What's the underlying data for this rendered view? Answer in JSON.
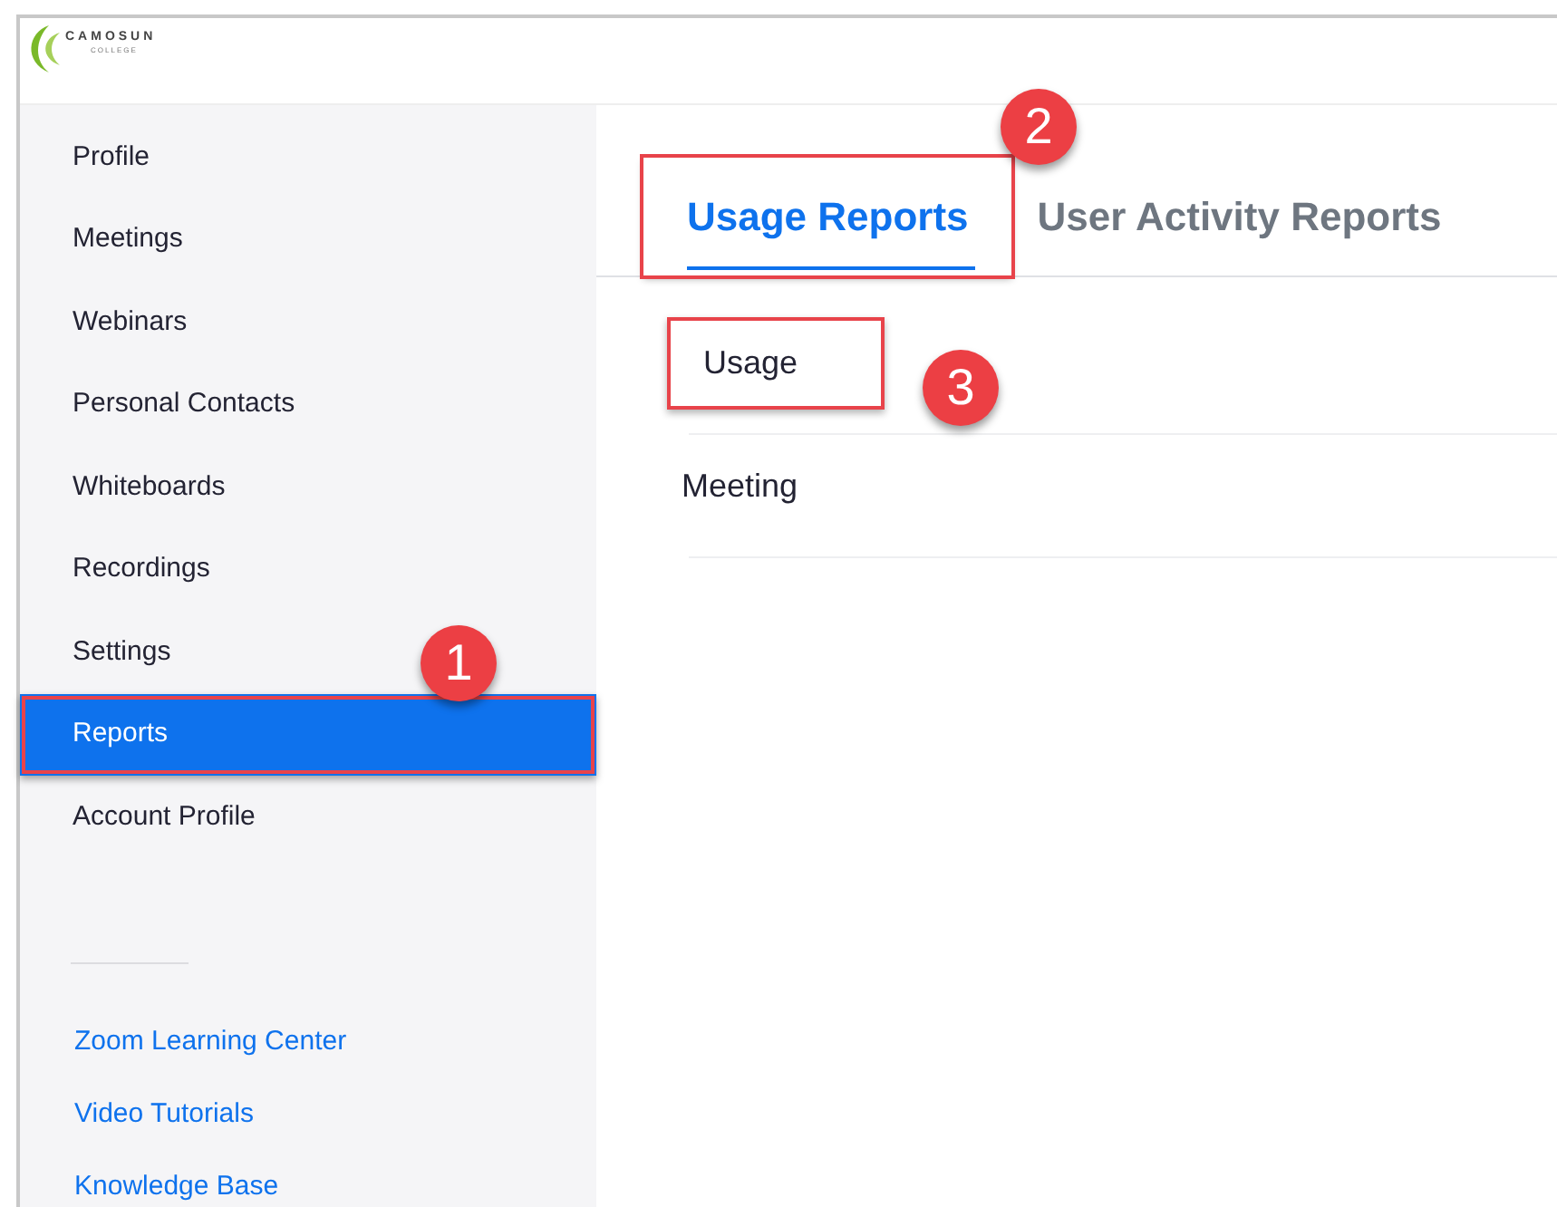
{
  "logo": {
    "name": "CAMOSUN",
    "subtitle": "COLLEGE"
  },
  "sidebar": {
    "items": [
      {
        "label": "Profile",
        "selected": false,
        "highlighted": false
      },
      {
        "label": "Meetings",
        "selected": false,
        "highlighted": false
      },
      {
        "label": "Webinars",
        "selected": false,
        "highlighted": false
      },
      {
        "label": "Personal Contacts",
        "selected": false,
        "highlighted": false
      },
      {
        "label": "Whiteboards",
        "selected": false,
        "highlighted": false
      },
      {
        "label": "Recordings",
        "selected": false,
        "highlighted": false
      },
      {
        "label": "Settings",
        "selected": false,
        "highlighted": false
      },
      {
        "label": "Reports",
        "selected": true,
        "highlighted": true
      },
      {
        "label": "Account Profile",
        "selected": false,
        "highlighted": false
      }
    ],
    "links": [
      "Zoom Learning Center",
      "Video Tutorials",
      "Knowledge Base"
    ]
  },
  "tabs": [
    {
      "label": "Usage Reports",
      "selected": true,
      "highlighted": true
    },
    {
      "label": "User Activity Reports",
      "selected": false,
      "highlighted": false
    }
  ],
  "reports": [
    {
      "label": "Usage",
      "highlighted": true
    },
    {
      "label": "Meeting",
      "highlighted": false
    }
  ],
  "callouts": [
    "1",
    "2",
    "3"
  ]
}
